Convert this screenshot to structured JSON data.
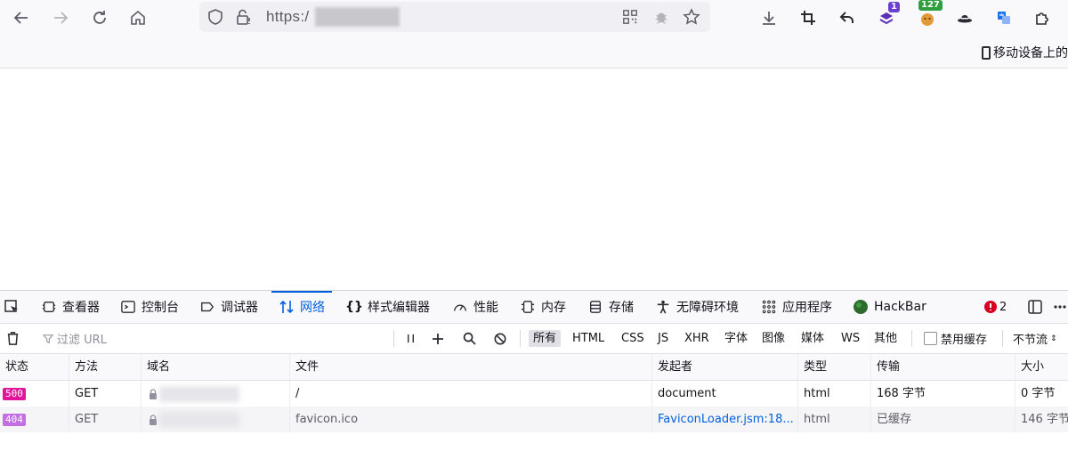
{
  "browser": {
    "url_prefix": "https:/",
    "bookmark_label": "移动设备上的",
    "extension_badges": {
      "ext1": "1",
      "ext2": "127"
    }
  },
  "devtools": {
    "tabs": [
      {
        "label": "查看器"
      },
      {
        "label": "控制台"
      },
      {
        "label": "调试器"
      },
      {
        "label": "网络"
      },
      {
        "label": "样式编辑器"
      },
      {
        "label": "性能"
      },
      {
        "label": "内存"
      },
      {
        "label": "存储"
      },
      {
        "label": "无障碍环境"
      },
      {
        "label": "应用程序"
      },
      {
        "label": "HackBar"
      }
    ],
    "error_count": "2",
    "filter_placeholder": "过滤 URL",
    "type_filters": [
      "所有",
      "HTML",
      "CSS",
      "JS",
      "XHR",
      "字体",
      "图像",
      "媒体",
      "WS",
      "其他"
    ],
    "disable_cache_label": "禁用缓存",
    "throttle_label": "不节流",
    "columns": [
      "状态",
      "方法",
      "域名",
      "文件",
      "发起者",
      "类型",
      "传输",
      "大小"
    ],
    "requests": [
      {
        "status": "500",
        "method": "GET",
        "file": "/",
        "initiator": "document",
        "type": "html",
        "transferred": "168 字节",
        "size": "0 字节"
      },
      {
        "status": "404",
        "method": "GET",
        "file": "favicon.ico",
        "initiator": "FaviconLoader.jsm:18...",
        "type": "html",
        "transferred": "已缓存",
        "size": "146 字节"
      }
    ],
    "colors": {
      "status_500": "#e0169d",
      "status_404": "#c46ee6",
      "accent": "#0060df"
    }
  }
}
